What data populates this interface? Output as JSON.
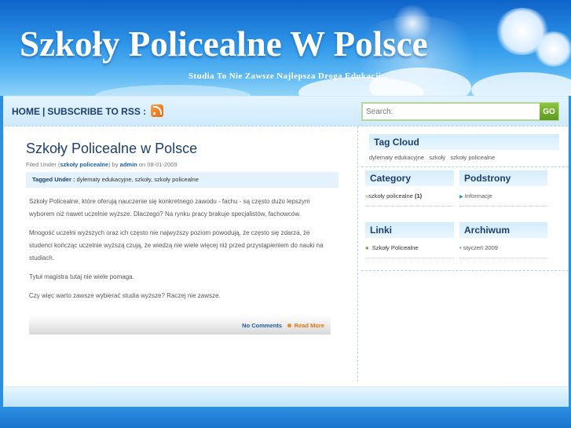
{
  "header": {
    "site_title": "Szkoły Policealne W Polsce",
    "tagline": "Studia To Nie Zawsze Najlepsza Droga Edukacji..."
  },
  "nav": {
    "home": "HOME",
    "separator": "|",
    "subscribe": "SUBSCRIBE TO RSS :",
    "rss_icon": "rss-icon"
  },
  "search": {
    "placeholder": "Search:",
    "button_label": "GO"
  },
  "post": {
    "title": "Szkoły Policealne w Polsce",
    "filed_under_prefix": "Filed Under (",
    "category": "szkoły policealne",
    "filed_under_suffix": ") by",
    "author": "admin",
    "on_label": "on 08-01-2009",
    "tagged_label": "Tagged Under :",
    "tags": "dylematy edukacyjne, szkoły, szkoły policealne",
    "paragraphs": [
      "Szkoły Policealne, które oferują nauczenie się konkretnego zawodu - fachu - są często dużo lepszym wyborem niż nawet uczelnie wyższe. Dlaczego? Na rynku pracy brakuje specjalistów,  fachowców.",
      "Mnogość uczelni wyższych oraz ich często nie najwyższy poziom powodują, że często się zdarza, że studenci kończąc uczelnie wyższą czują, że wiedzą nie wiele więcej niż przed przystąpieniem do nauki na studiach.",
      "Tytuł magistra tutaj nie wiele pomaga.",
      "Czy więc warto zawsze wybierać studia wyższe? Raczej nie zawsze."
    ],
    "no_comments": "No Comments",
    "read_more": "Read More"
  },
  "sidebar": {
    "tag_cloud": {
      "title": "Tag Cloud",
      "tags": [
        "dylematy edukacyjne",
        "szkoły",
        "szkoły policealne"
      ]
    },
    "category": {
      "title": "Category",
      "item": "szkoły policealne",
      "count": "(1)"
    },
    "podstrony": {
      "title": "Podstrony",
      "item": "Informacje"
    },
    "linki": {
      "title": "Linki",
      "item": "Szkoły Policealne"
    },
    "archiwum": {
      "title": "Archiwum",
      "item": "styczeń 2009"
    }
  },
  "colors": {
    "header_blue": "#2d95e8",
    "title_navy": "#1c3f6e",
    "link_blue": "#1c5fa8",
    "accent_orange": "#e8730c",
    "go_green": "#6aa82a"
  }
}
